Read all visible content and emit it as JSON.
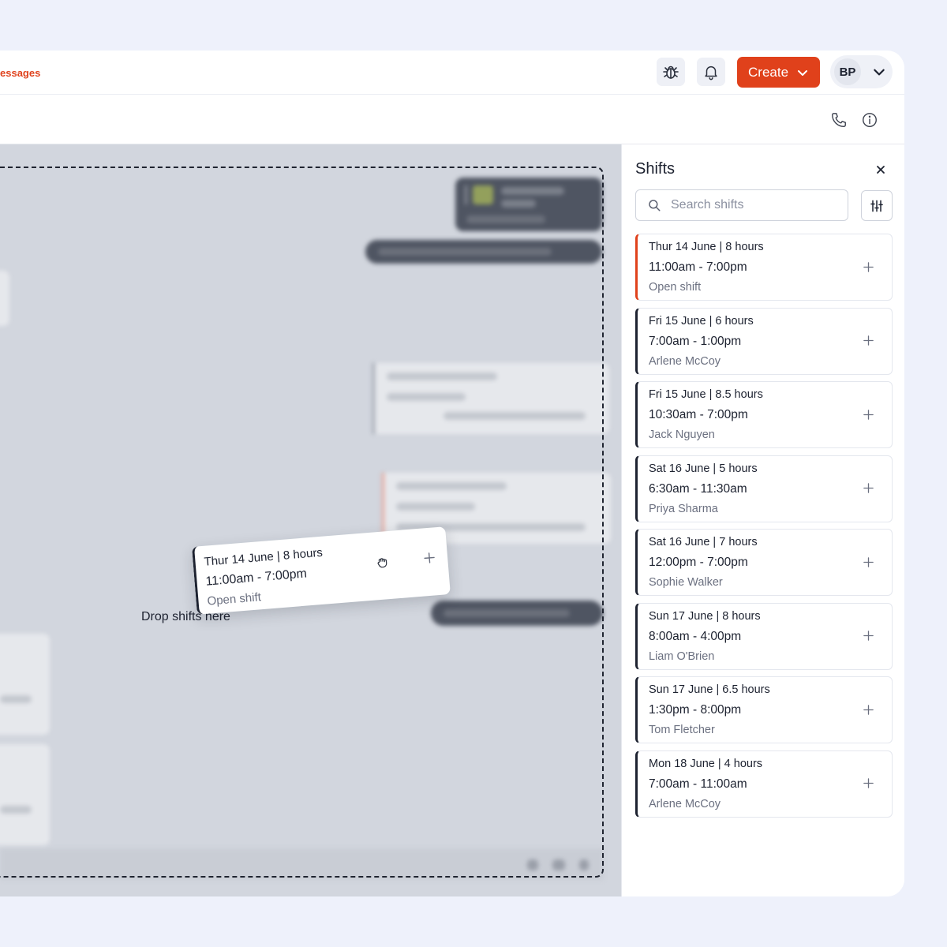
{
  "topbar": {
    "nav_link": "essages",
    "create_label": "Create",
    "user_initials": "BP"
  },
  "chat": {
    "drop_label": "Drop shifts here",
    "dragged_shift": {
      "date": "Thur 14 June",
      "hours": "8 hours",
      "time": "11:00am - 7:00pm",
      "assignee": "Open shift"
    }
  },
  "panel": {
    "title": "Shifts",
    "search_placeholder": "Search shifts",
    "shifts": [
      {
        "date": "Thur 14 June",
        "hours": "8 hours",
        "time": "11:00am - 7:00pm",
        "assignee": "Open shift",
        "open": true
      },
      {
        "date": "Fri 15 June",
        "hours": "6 hours",
        "time": "7:00am - 1:00pm",
        "assignee": "Arlene McCoy",
        "open": false
      },
      {
        "date": "Fri 15 June",
        "hours": "8.5 hours",
        "time": "10:30am - 7:00pm",
        "assignee": "Jack Nguyen",
        "open": false
      },
      {
        "date": "Sat 16 June",
        "hours": "5 hours",
        "time": "6:30am - 11:30am",
        "assignee": "Priya Sharma",
        "open": false
      },
      {
        "date": "Sat 16 June",
        "hours": "7 hours",
        "time": "12:00pm - 7:00pm",
        "assignee": "Sophie Walker",
        "open": false
      },
      {
        "date": "Sun 17 June",
        "hours": "8 hours",
        "time": "8:00am - 4:00pm",
        "assignee": "Liam O'Brien",
        "open": false
      },
      {
        "date": "Sun 17 June",
        "hours": "6.5 hours",
        "time": "1:30pm - 8:00pm",
        "assignee": "Tom Fletcher",
        "open": false
      },
      {
        "date": "Mon 18 June",
        "hours": "4 hours",
        "time": "7:00am - 11:00am",
        "assignee": "Arlene McCoy",
        "open": false
      }
    ]
  },
  "colors": {
    "accent": "#e0411b",
    "text": "#1d2230",
    "chat_bg": "#d2d6de"
  },
  "icons": [
    "bug-icon",
    "bell-icon",
    "chevron-down-icon",
    "phone-icon",
    "info-icon",
    "close-icon",
    "search-icon",
    "sliders-icon",
    "plus-icon",
    "grab-hand-icon"
  ]
}
